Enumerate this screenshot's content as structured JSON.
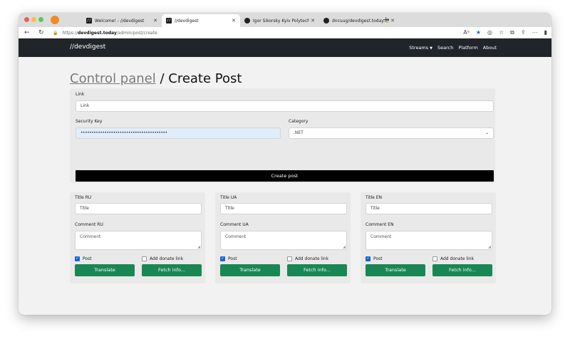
{
  "browser": {
    "tabs": [
      {
        "title": "Welcome! - //devdigest",
        "favicon": "//"
      },
      {
        "title": "//devdigest",
        "favicon": "//"
      },
      {
        "title": "Igor Sikorsky Kyiv Polytechnic I",
        "favicon": "gh"
      },
      {
        "title": "dncuug/devdigest.today: 🇺🇦 W",
        "favicon": "gh"
      }
    ],
    "url_prefix": "https://",
    "url_host": "devdigest.today",
    "url_path": "/admin/post/create"
  },
  "navbar": {
    "brand": "//devdigest",
    "links": [
      "Streams",
      "Search",
      "Platform",
      "About"
    ]
  },
  "page": {
    "breadcrumb": "Control panel",
    "separator": " / ",
    "title": "Create Post"
  },
  "form": {
    "link_label": "Link",
    "link_placeholder": "Link",
    "security_key_label": "Security Key",
    "security_key_value": "••••••••••••••••••••••••••••••••••••••••",
    "category_label": "Category",
    "category_value": ".NET",
    "create_button": "Create post"
  },
  "cards": [
    {
      "title_label": "Title RU",
      "title_placeholder": "Title",
      "comment_label": "Comment RU",
      "comment_placeholder": "Comment",
      "post_label": "Post",
      "post_checked": true,
      "donate_label": "Add donate link",
      "donate_checked": false,
      "translate": "Translate",
      "fetch": "Fetch info..."
    },
    {
      "title_label": "Title UA",
      "title_placeholder": "Title",
      "comment_label": "Comment UA",
      "comment_placeholder": "Comment",
      "post_label": "Post",
      "post_checked": true,
      "donate_label": "Add donate link",
      "donate_checked": false,
      "translate": "Translate",
      "fetch": "Fetch info..."
    },
    {
      "title_label": "Title EN",
      "title_placeholder": "Title",
      "comment_label": "Comment EN",
      "comment_placeholder": "Comment",
      "post_label": "Post",
      "post_checked": true,
      "donate_label": "Add donate link",
      "donate_checked": false,
      "translate": "Translate",
      "fetch": "Fetch info..."
    }
  ],
  "colors": {
    "navbar": "#212529",
    "primary_button": "#000000",
    "success_button": "#198754",
    "checkbox": "#1a66d0"
  }
}
